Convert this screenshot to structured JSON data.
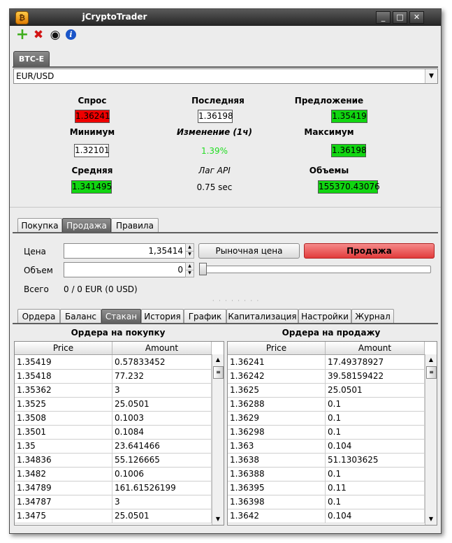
{
  "window": {
    "title": "jCryptoTrader",
    "buttons": {
      "minimize": "_",
      "maximize": "□",
      "close": "✕"
    }
  },
  "toolbar": {
    "icons": [
      "add-icon",
      "delete-icon",
      "eye-icon",
      "info-icon"
    ],
    "glyphs": {
      "add": "+",
      "delete": "✖",
      "eye": "◉",
      "info": "i"
    }
  },
  "exchange_tab": "BTC-E",
  "pair_select": {
    "value": "EUR/USD",
    "arrow": "▼"
  },
  "ticker": {
    "bid": {
      "label": "Спрос",
      "value": "1.36241"
    },
    "last": {
      "label": "Последняя",
      "value": "1.36198"
    },
    "ask": {
      "label": "Предложение",
      "value": "1.35419"
    },
    "low": {
      "label": "Минимум",
      "value": "1.32101"
    },
    "change": {
      "label": "Изменение (1ч)",
      "value": "1.39%"
    },
    "high": {
      "label": "Максимум",
      "value": "1.36198"
    },
    "avg": {
      "label": "Средняя",
      "value": "1.341495"
    },
    "lag": {
      "label": "Лаг API",
      "value": "0.75 sec"
    },
    "volume": {
      "label": "Объемы",
      "value": "155370.43076"
    }
  },
  "order_tabs": [
    "Покупка",
    "Продажа",
    "Правила"
  ],
  "order_tab_active": "Продажа",
  "order_form": {
    "price_label": "Цена",
    "price_value": "1,35414",
    "market_price_button": "Рыночная цена",
    "sell_button": "Продажа",
    "volume_label": "Объем",
    "volume_value": "0",
    "total_label": "Всего",
    "total_value": "0 / 0 EUR (0 USD)",
    "volume_slider_fraction": 0,
    "spin_up": "▲",
    "spin_down": "▼"
  },
  "splitter_dots": "· · · · · · · ·",
  "bottom_tabs": [
    "Ордера",
    "Баланс",
    "Стакан",
    "История",
    "График",
    "Капитализация",
    "Настройки",
    "Журнал"
  ],
  "bottom_tab_active": "Стакан",
  "orderbook": {
    "buy": {
      "title": "Ордера на покупку",
      "columns": [
        "Price",
        "Amount"
      ],
      "rows": [
        [
          "1.35419",
          "0.57833452"
        ],
        [
          "1.35418",
          "77.232"
        ],
        [
          "1.35362",
          "3"
        ],
        [
          "1.3525",
          "25.0501"
        ],
        [
          "1.3508",
          "0.1003"
        ],
        [
          "1.3501",
          "0.1084"
        ],
        [
          "1.35",
          "23.641466"
        ],
        [
          "1.34836",
          "55.126665"
        ],
        [
          "1.3482",
          "0.1006"
        ],
        [
          "1.34789",
          "161.61526199"
        ],
        [
          "1.34787",
          "3"
        ],
        [
          "1.3475",
          "25.0501"
        ]
      ]
    },
    "sell": {
      "title": "Ордера на продажу",
      "columns": [
        "Price",
        "Amount"
      ],
      "rows": [
        [
          "1.36241",
          "17.49378927"
        ],
        [
          "1.36242",
          "39.58159422"
        ],
        [
          "1.3625",
          "25.0501"
        ],
        [
          "1.36288",
          "0.1"
        ],
        [
          "1.3629",
          "0.1"
        ],
        [
          "1.36298",
          "0.1"
        ],
        [
          "1.363",
          "0.104"
        ],
        [
          "1.3638",
          "51.1303625"
        ],
        [
          "1.36388",
          "0.1"
        ],
        [
          "1.36395",
          "0.11"
        ],
        [
          "1.36398",
          "0.1"
        ],
        [
          "1.3642",
          "0.104"
        ]
      ]
    },
    "scroll": {
      "up": "▲",
      "down": "▼",
      "thumb": "≡"
    }
  },
  "colors": {
    "bid_box": "#ef0000",
    "green_box": "#11d611",
    "change_text": "#22dd22",
    "sell_button": "#e23b3b"
  }
}
